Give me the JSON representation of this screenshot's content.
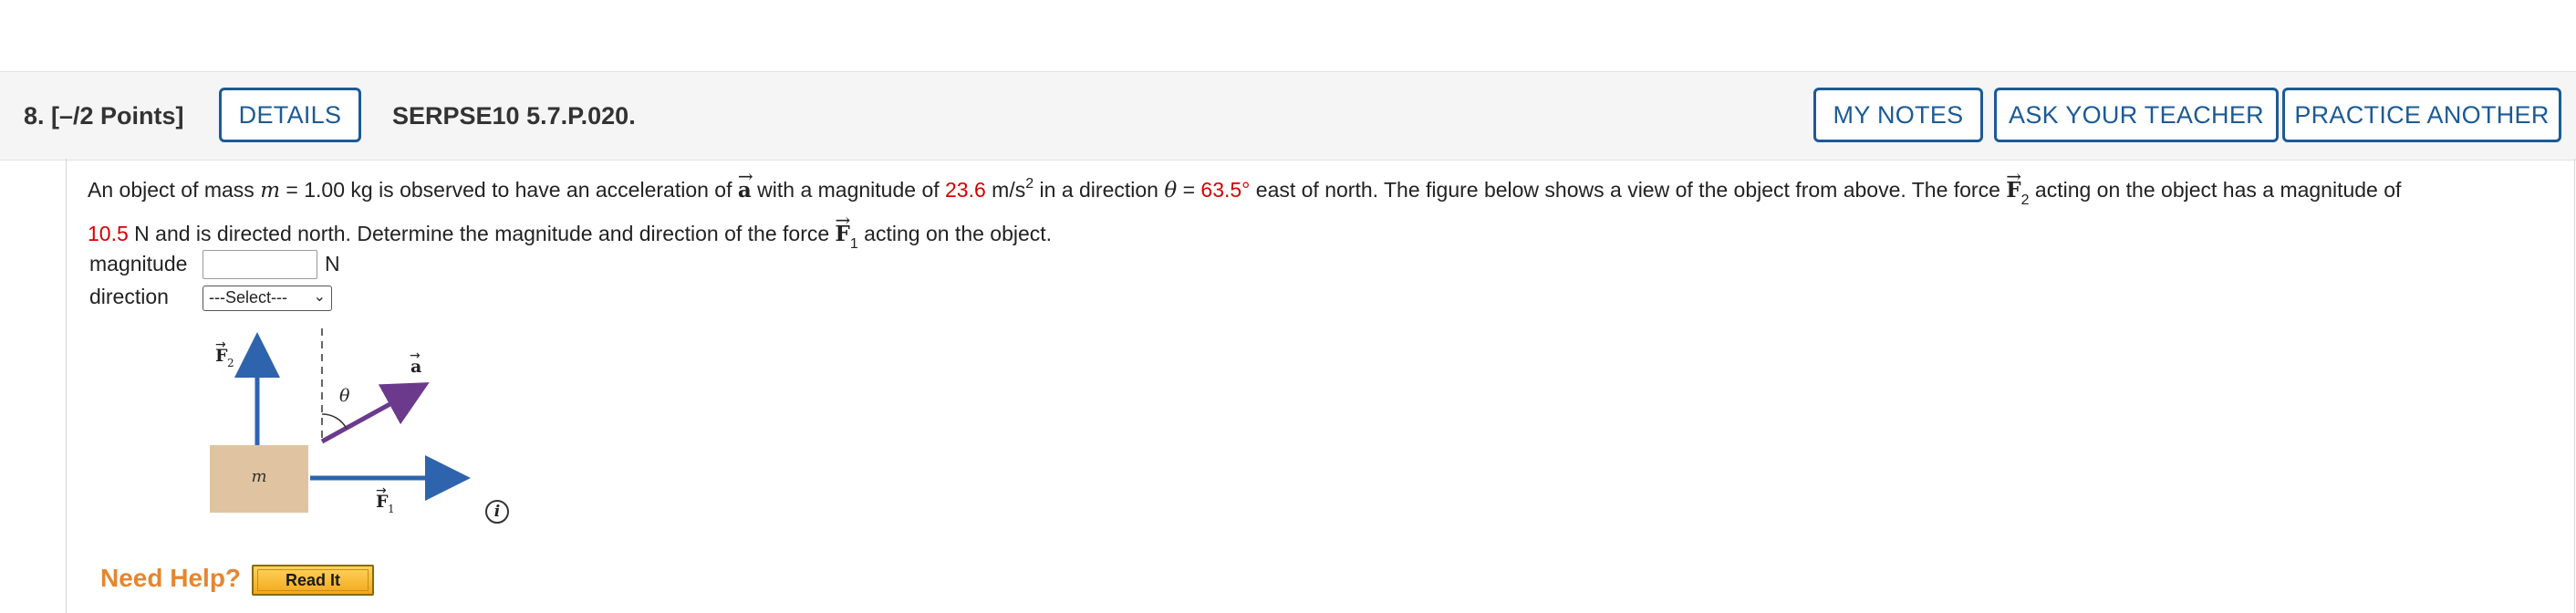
{
  "header": {
    "question_number": "8. [–/2 Points]",
    "details_label": "DETAILS",
    "code": "SERPSE10 5.7.P.020.",
    "my_notes_label": "MY NOTES",
    "ask_teacher_label": "ASK YOUR TEACHER",
    "practice_another_label": "PRACTICE ANOTHER"
  },
  "problem": {
    "t1": "An object of mass ",
    "mass_symbol": "m",
    "t2": " = 1.00 kg is observed to have an acceleration of ",
    "accel_vec": "a",
    "t3": " with a magnitude of ",
    "accel_value": "23.6",
    "accel_unit": " m/s",
    "accel_exp": "2",
    "t4": " in a direction ",
    "theta_symbol": "θ",
    "t5": " = ",
    "angle_value": "63.5°",
    "t6": " east of north. The figure below shows a view of the object from above. The force ",
    "force2_vec": "F",
    "force2_sub": "2",
    "t7": " acting on the object has a magnitude of",
    "force2_value": "10.5",
    "t8": " N and is directed north. Determine the magnitude and direction of the force ",
    "force1_vec": "F",
    "force1_sub": "1",
    "t9": " acting on the object."
  },
  "answers": {
    "magnitude_label": "magnitude",
    "magnitude_value": "",
    "magnitude_unit": "N",
    "direction_label": "direction",
    "direction_selected": "---Select---"
  },
  "figure": {
    "mass_label": "m",
    "f2_label": "F",
    "f2_sub": "2",
    "f1_label": "F",
    "f1_sub": "1",
    "a_label": "a",
    "theta_label": "θ",
    "arrow_color": "#2e63ad",
    "accel_color": "#6b3a8c",
    "block_color": "#e0c4a1"
  },
  "help": {
    "need_help_label": "Need Help?",
    "read_it_label": "Read It"
  }
}
